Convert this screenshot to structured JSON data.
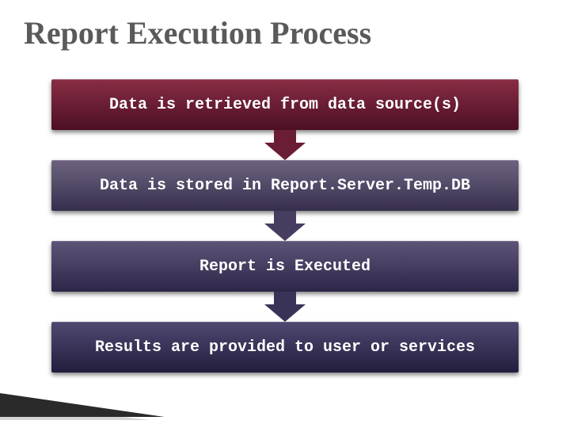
{
  "title": "Report Execution Process",
  "steps": [
    {
      "label": "Data is retrieved from data source(s)"
    },
    {
      "label": "Data is stored in Report.Server.Temp.DB"
    },
    {
      "label": "Report is Executed"
    },
    {
      "label": "Results are provided to user or services"
    }
  ]
}
